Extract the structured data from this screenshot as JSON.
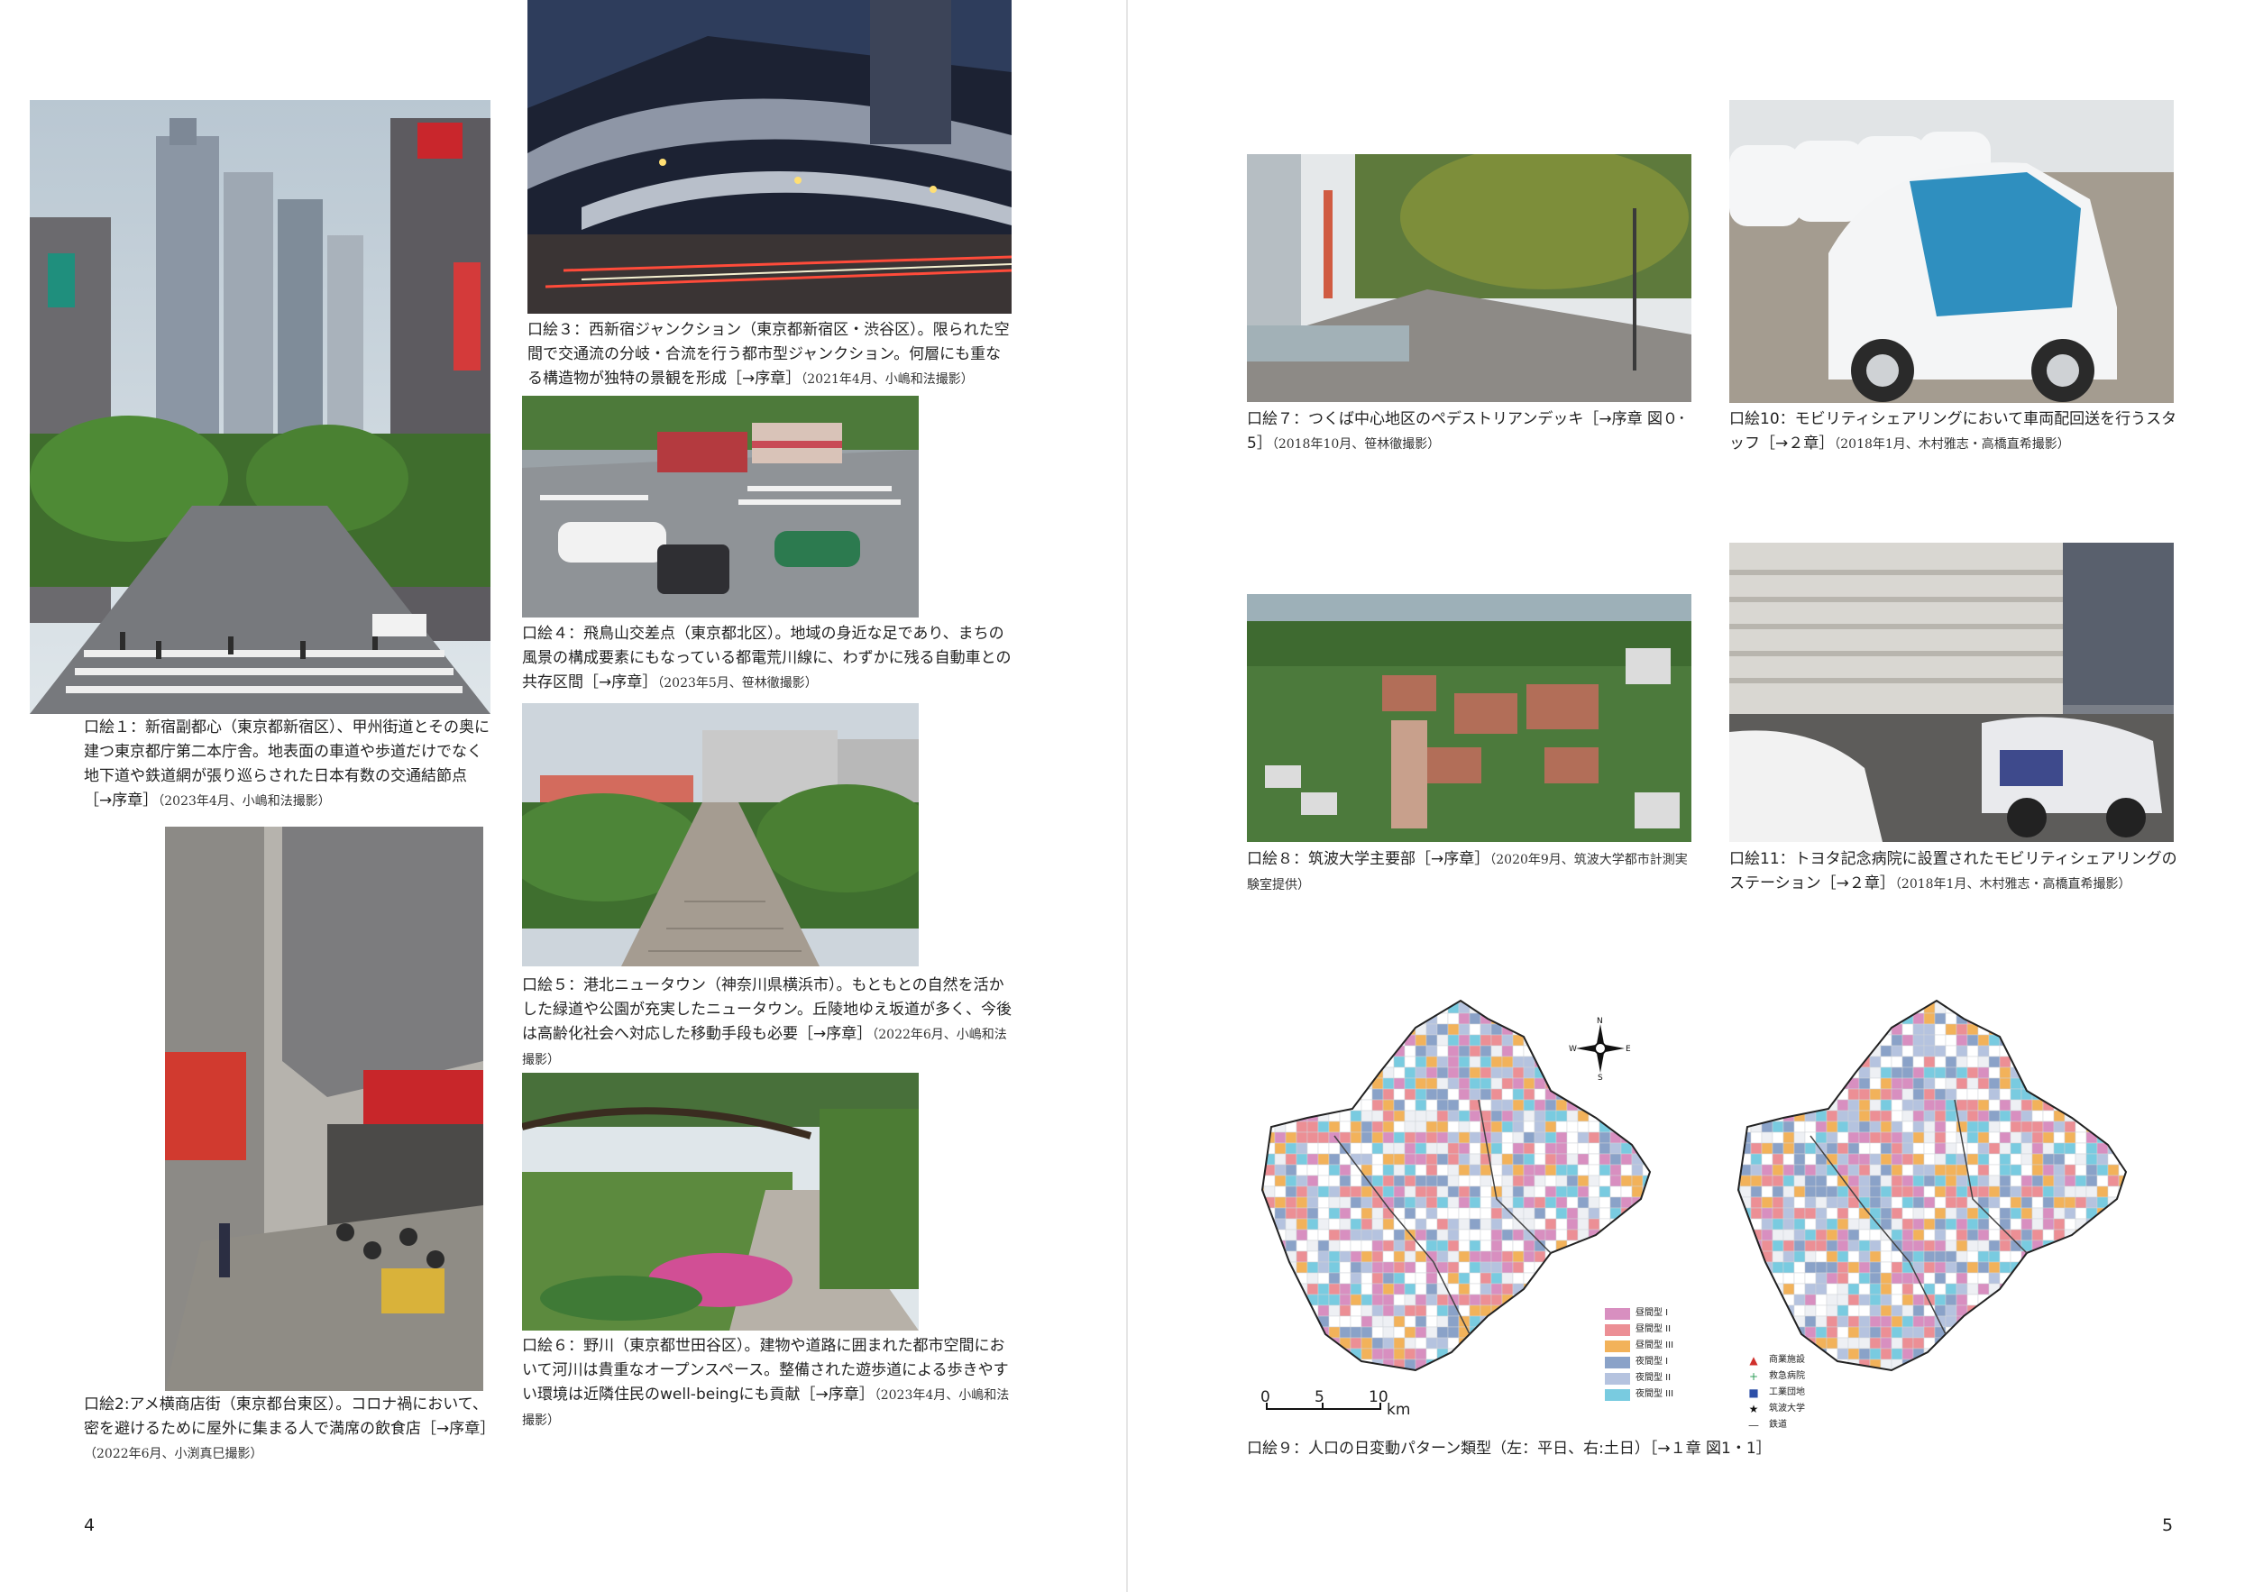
{
  "left_page": {
    "page_number": "4",
    "figures": [
      {
        "id": "fig1",
        "icon": "city-avenue-photo",
        "text": "口絵１：新宿副都心（東京都新宿区）、甲州街道とその奥に建つ東京都庁第二本庁舎。地表面の車道や歩道だけでなく地下道や鉄道網が張り巡らされた日本有数の交通結節点［→序章］",
        "meta": "（2023年4月、小嶋和法撮影）"
      },
      {
        "id": "fig2",
        "icon": "street-cafe-photo",
        "text": "口絵2:アメ横商店街（東京都台東区）。コロナ禍において、密を避けるために屋外に集まる人で満席の飲食店［→序章］",
        "meta": "（2022年6月、小渕真巳撮影）"
      },
      {
        "id": "fig3",
        "icon": "highway-junction-photo",
        "text": "口絵３：西新宿ジャンクション（東京都新宿区・渋谷区）。限られた空間で交通流の分岐・合流を行う都市型ジャンクション。何層にも重なる構造物が独特の景観を形成［→序章］",
        "meta": "（2021年4月、小嶋和法撮影）"
      },
      {
        "id": "fig4",
        "icon": "tram-intersection-photo",
        "text": "口絵４：飛鳥山交差点（東京都北区）。地域の身近な足であり、まちの風景の構成要素にもなっている都電荒川線に、わずかに残る自動車との共存区間［→序章］",
        "meta": "（2023年5月、笹林徹撮影）"
      },
      {
        "id": "fig5",
        "icon": "new-town-stairs-photo",
        "text": "口絵５：港北ニュータウン（神奈川県横浜市）。もともとの自然を活かした緑道や公園が充実したニュータウン。丘陵地ゆえ坂道が多く、今後は高齢化社会へ対応した移動手段も必要［→序章］",
        "meta": "（2022年6月、小嶋和法撮影）"
      },
      {
        "id": "fig6",
        "icon": "river-promenade-photo",
        "text": "口絵６：野川（東京都世田谷区）。建物や道路に囲まれた都市空間において河川は貴重なオープンスペース。整備された遊歩道による歩きやすい環境は近隣住民のwell-beingにも貢献［→序章］",
        "meta": "（2023年4月、小嶋和法撮影）"
      }
    ]
  },
  "right_page": {
    "page_number": "5",
    "figures": [
      {
        "id": "fig7",
        "icon": "pedestrian-deck-photo",
        "text": "口絵７：つくば中心地区のペデストリアンデッキ［→序章 図０･5］",
        "meta": "（2018年10月、笹林徹撮影）"
      },
      {
        "id": "fig8",
        "icon": "campus-aerial-photo",
        "text": "口絵８：筑波大学主要部［→序章］",
        "meta": "（2020年9月、筑波大学都市計測実験室提供）"
      },
      {
        "id": "fig10",
        "icon": "micro-ev-photo",
        "text": "口絵10：モビリティシェアリングにおいて車両配回送を行うスタッフ［→２章］",
        "meta": "（2018年1月、木村雅志・高橋直希撮影）"
      },
      {
        "id": "fig11",
        "icon": "hospital-station-photo",
        "text": "口絵11：トヨタ記念病院に設置されたモビリティシェアリングのステーション［→２章］",
        "meta": "（2018年1月、木村雅志・高橋直希撮影）"
      }
    ],
    "map_figure": {
      "caption": "口絵９：人口の日変動パターン類型（左：平日、右:土日）［→１章 図1・1］",
      "compass": {
        "n": "N",
        "s": "S",
        "e": "E",
        "w": "W"
      },
      "scale": {
        "labels": [
          "0",
          "5",
          "10"
        ],
        "unit": "km"
      },
      "pattern_legend": [
        {
          "label": "昼間型 I",
          "color": "#d88fc0"
        },
        {
          "label": "昼間型 II",
          "color": "#ec8f95"
        },
        {
          "label": "昼間型 III",
          "color": "#f2b25a"
        },
        {
          "label": "夜間型 I",
          "color": "#8aa2c8"
        },
        {
          "label": "夜間型 II",
          "color": "#b5c3df"
        },
        {
          "label": "夜間型 III",
          "color": "#79cbe0"
        }
      ],
      "facility_legend": [
        {
          "label": "商業施設",
          "symbol": "▲",
          "color": "#d0302c"
        },
        {
          "label": "救急病院",
          "symbol": "+",
          "color": "#2f9e5a"
        },
        {
          "label": "工業団地",
          "symbol": "■",
          "color": "#2d4fa8"
        },
        {
          "label": "筑波大学",
          "symbol": "★",
          "color": "#111111"
        },
        {
          "label": "鉄道",
          "symbol": "—",
          "color": "#444444"
        }
      ]
    }
  }
}
